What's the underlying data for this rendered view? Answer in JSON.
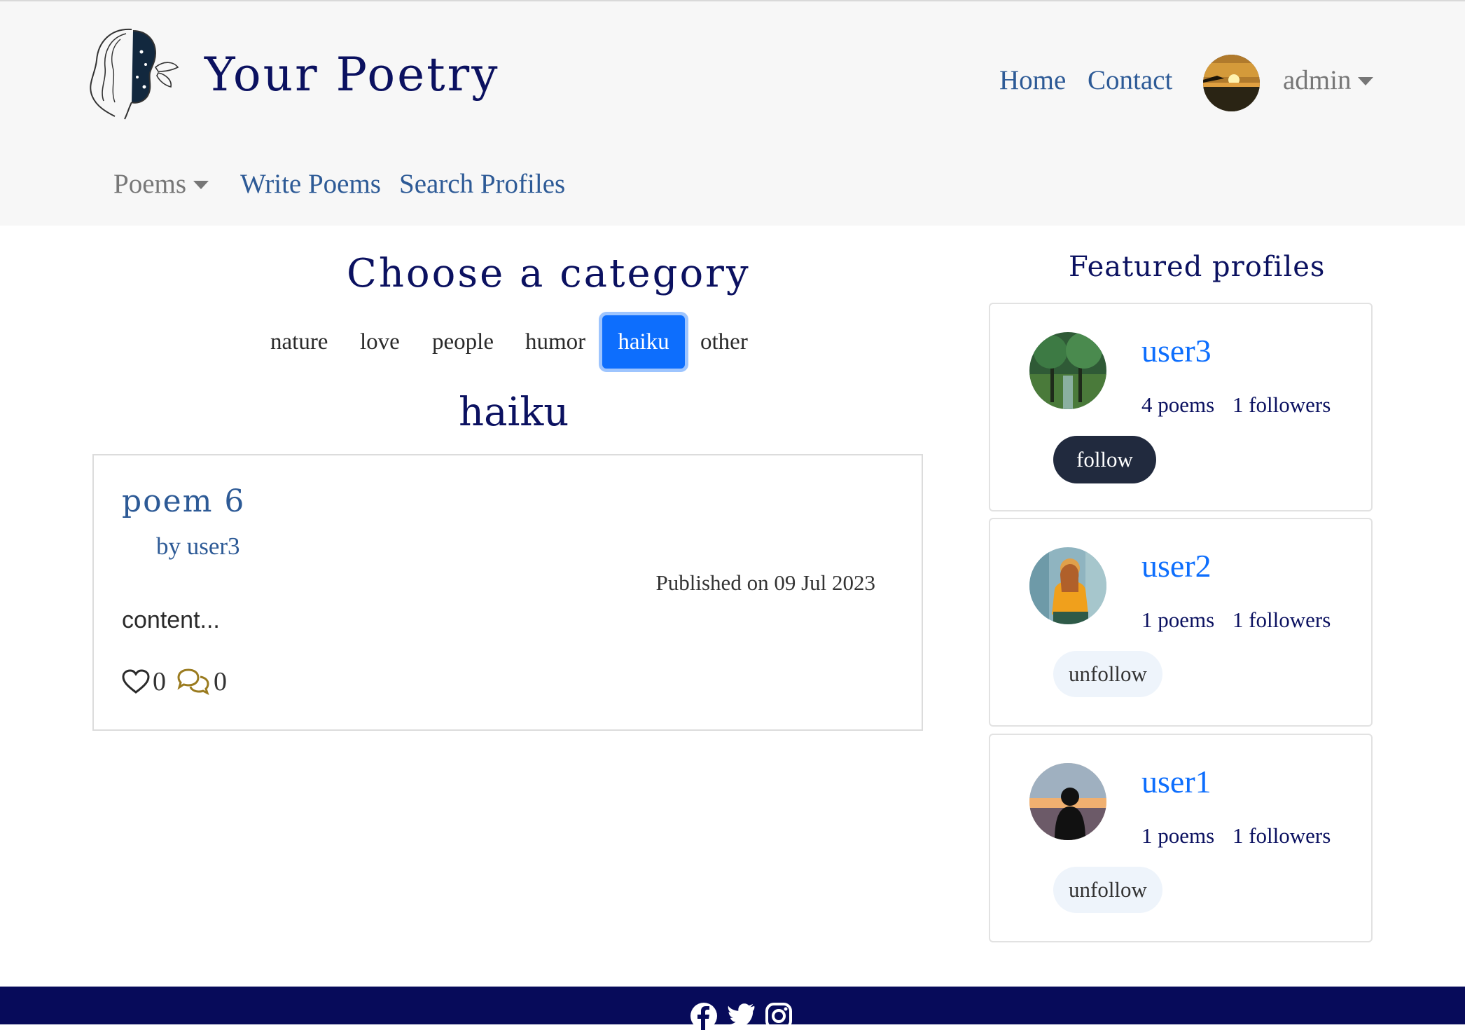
{
  "header": {
    "brand": "Your Poetry",
    "nav": {
      "home": "Home",
      "contact": "Contact"
    },
    "user": {
      "name": "admin"
    },
    "subnav": {
      "poems": "Poems",
      "write": "Write Poems",
      "search": "Search Profiles"
    }
  },
  "main": {
    "heading": "Choose a category",
    "categories": [
      "nature",
      "love",
      "people",
      "humor",
      "haiku",
      "other"
    ],
    "selected_category": "haiku",
    "category_heading": "haiku",
    "poem": {
      "title": "poem 6",
      "author": "by user3",
      "published": "Published on 09 Jul 2023",
      "content": "content...",
      "likes": "0",
      "comments": "0"
    }
  },
  "sidebar": {
    "heading": "Featured profiles",
    "profiles": [
      {
        "name": "user3",
        "poems": "4 poems",
        "followers": "1 followers",
        "action": "follow"
      },
      {
        "name": "user2",
        "poems": "1 poems",
        "followers": "1 followers",
        "action": "unfollow"
      },
      {
        "name": "user1",
        "poems": "1 poems",
        "followers": "1 followers",
        "action": "unfollow"
      }
    ]
  },
  "footer": {
    "icons": [
      "facebook-icon",
      "twitter-icon",
      "instagram-icon"
    ]
  },
  "colors": {
    "brand": "#0b1160",
    "link": "#2d5a96",
    "accent": "#0d6efd",
    "footer": "#070b5a",
    "comment_icon": "#9a7b1f"
  }
}
